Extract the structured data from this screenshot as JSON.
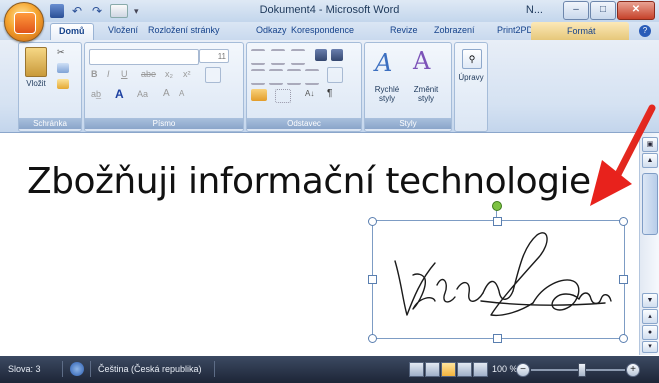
{
  "window": {
    "title": "Dokument4 - Microsoft Word",
    "instance_label": "N...",
    "controls": {
      "minimize": "–",
      "maximize": "□",
      "close": "✕"
    }
  },
  "qat": {
    "undo_glyph": "↶",
    "redo_glyph": "↷",
    "spell_label": "ABC 123",
    "more_glyph": "▾"
  },
  "tabs": [
    {
      "label": "Domů",
      "active": true
    },
    {
      "label": "Vložení"
    },
    {
      "label": "Rozložení stránky"
    },
    {
      "label": "Odkazy"
    },
    {
      "label": "Korespondence"
    },
    {
      "label": "Revize"
    },
    {
      "label": "Zobrazení"
    },
    {
      "label": "Print2PDF"
    }
  ],
  "context_tab": "Formát",
  "help_glyph": "?",
  "ribbon": {
    "groups": {
      "clipboard": {
        "label": "Schránka",
        "paste_label": "Vložit"
      },
      "font": {
        "label": "Písmo",
        "size_value": "11",
        "bold": "B",
        "italic": "I",
        "underline": "U",
        "strike": "abe",
        "sub": "x₂",
        "sup": "x²",
        "highlight": "ab̲",
        "color_a": "A",
        "case": "Aa",
        "grow": "A",
        "shrink": "A"
      },
      "paragraph": {
        "label": "Odstavec",
        "sort": "A↓",
        "pilcrow": "¶"
      },
      "styles": {
        "label": "Styly",
        "quick_styles": "Rychlé styly",
        "change_styles": "Změnit styly"
      },
      "editing": {
        "label": "Úpravy"
      }
    }
  },
  "document": {
    "text": "Zbožňuji informační technologie",
    "signature_alt": "handwritten signature"
  },
  "statusbar": {
    "words": "Slova: 3",
    "language": "Čeština (Česká republika)",
    "zoom": "100 %",
    "zoom_minus": "−",
    "zoom_plus": "+"
  },
  "colors": {
    "annotation_arrow": "#e8221c",
    "title_text": "#1e395b",
    "tab_text": "#15428b"
  }
}
